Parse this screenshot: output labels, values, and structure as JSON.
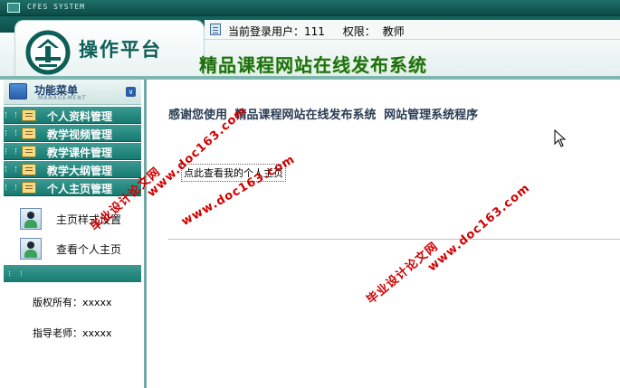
{
  "window": {
    "title": "CFES SYSTEM"
  },
  "header": {
    "platform_title": "操作平台",
    "site_title": "精品课程网站在线发布系统",
    "user_label": "当前登录用户：111",
    "role_label": "权限：",
    "role_value": "教师"
  },
  "sidebar": {
    "menu_title": "功能菜单",
    "menu_subtitle": "MANAGEMENT",
    "items": [
      {
        "label": "个人资料管理"
      },
      {
        "label": "教学视频管理"
      },
      {
        "label": "教学课件管理"
      },
      {
        "label": "教学大纲管理"
      },
      {
        "label": "个人主页管理"
      }
    ],
    "subitems": [
      {
        "label": "主页样式设置"
      },
      {
        "label": "查看个人主页"
      }
    ],
    "copyright_label": "版权所有：xxxxx",
    "advisor_label": "指导老师：xxxxx"
  },
  "main": {
    "thanks_prefix": "感谢您使用",
    "system_name": "精品课程网站在线发布系统",
    "program_name": "网站管理系统程序",
    "personal_page_link": "点此查看我的个人主页"
  },
  "watermarks": [
    {
      "line1": "毕业设计论文网",
      "line2": "www.doc163.com"
    },
    {
      "line1": "毕业设计论文网",
      "line2": "www.doc163.com"
    },
    {
      "line1": "毕业设计论文网",
      "line2": "www.doc163.com"
    }
  ],
  "colors": {
    "accent_teal": "#177a71",
    "header_green_text": "#1e6e14",
    "watermark_red": "#d20000"
  }
}
